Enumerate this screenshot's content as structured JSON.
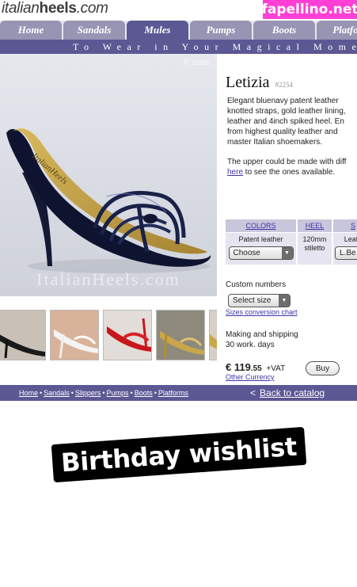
{
  "header": {
    "logo_part1": "italian",
    "logo_part2": "heels",
    "logo_part3": ".com",
    "watermark": "fapellino.net"
  },
  "nav": {
    "tabs": [
      "Home",
      "Sandals",
      "Mules",
      "Pumps",
      "Boots",
      "Platfor"
    ],
    "active_tab": "Mules",
    "tagline": "To Wear in Your Magical Moment"
  },
  "hero": {
    "watermark": "ItalianHeels.com",
    "zoom_label": "⚲ zoom"
  },
  "product": {
    "name": "Letizia",
    "code": "#2254",
    "description": [
      "Elegant bluenavy patent leather",
      "knotted straps, gold leather lining,",
      "leather and 4inch spiked heel. En",
      "from highest quality leather and",
      "master Italian shoemakers."
    ],
    "upper_text_1": "The upper could be made with diff",
    "upper_link": "here",
    "upper_text_2": " to see the ones available."
  },
  "options": {
    "headers": [
      "COLORS",
      "HEEL",
      "S"
    ],
    "color_value": "Patent leather",
    "color_select": "Choose",
    "heel_value_1": "120mm",
    "heel_value_2": "stiletto",
    "sole_value": "Leath",
    "sole_select": "L.Be"
  },
  "sizing": {
    "custom_label": "Custom numbers",
    "size_select": "Select size",
    "conversion_link": "Sizes conversion chart"
  },
  "shipping": {
    "line1": "Making and shipping",
    "line2": "30 work. days"
  },
  "pricing": {
    "currency": "€",
    "price_whole": "119",
    "price_cents": ".55",
    "vat": "+VAT",
    "buy_label": "Buy",
    "other_currency": "Other Currency"
  },
  "footer": {
    "links": [
      "Home",
      "Sandals",
      "Slippers",
      "Pumps",
      "Boots",
      "Platforms"
    ],
    "separator": "•",
    "back_arrow": "<",
    "back_label": "Back to catalog"
  },
  "sticker": {
    "text": "Birthday wishlist"
  },
  "colors": {
    "brand_purple": "#5c5894",
    "tab_inactive": "#9794b4",
    "watermark_pink": "#ff3fd6",
    "link_blue": "#3c35a8"
  }
}
